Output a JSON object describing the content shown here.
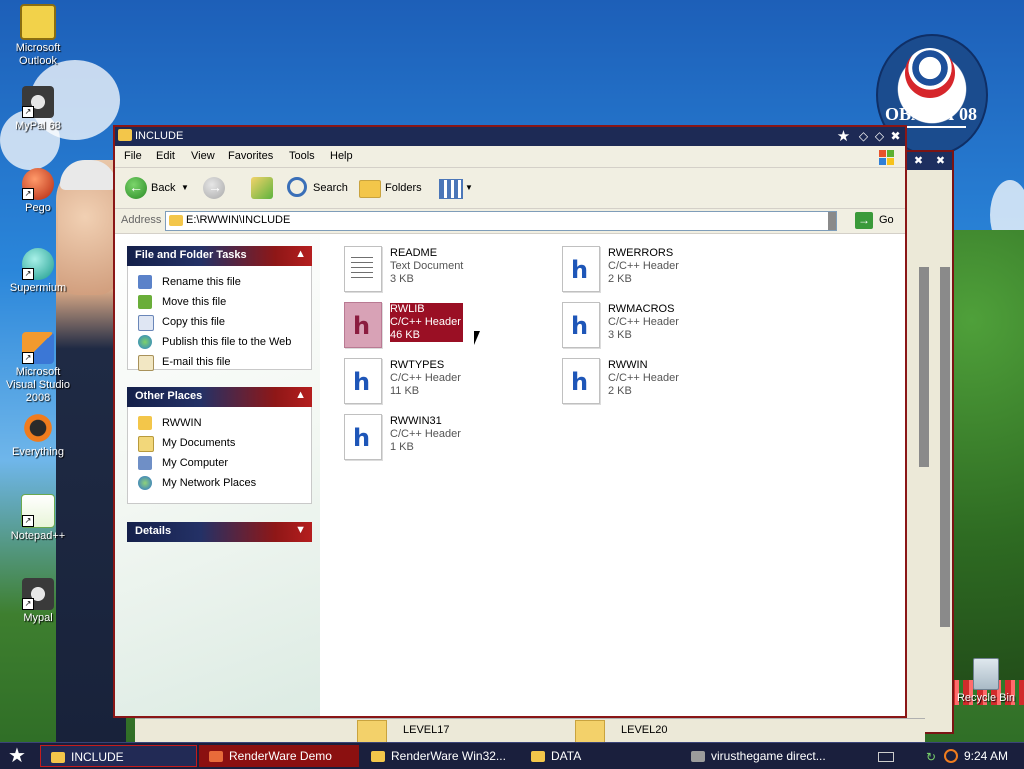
{
  "desktop": {
    "icons": [
      {
        "label": "Microsoft Outlook"
      },
      {
        "label": "MyPal 68"
      },
      {
        "label": "Pego"
      },
      {
        "label": "Supermium"
      },
      {
        "label": "Microsoft Visual Studio 2008"
      },
      {
        "label": "Everything"
      },
      {
        "label": "Notepad++"
      },
      {
        "label": "Mypal"
      },
      {
        "label": "Recycle Bin"
      }
    ],
    "badge_text": "OBAMA'08"
  },
  "window": {
    "title": "INCLUDE",
    "menu": [
      "File",
      "Edit",
      "View",
      "Favorites",
      "Tools",
      "Help"
    ],
    "toolbar": {
      "back": "Back",
      "search": "Search",
      "folders": "Folders"
    },
    "address": {
      "label": "Address",
      "path": "E:\\RWWIN\\INCLUDE",
      "go": "Go"
    }
  },
  "taskpane": {
    "file_tasks": {
      "title": "File and Folder Tasks",
      "items": [
        "Rename this file",
        "Move this file",
        "Copy this file",
        "Publish this file to the Web",
        "E-mail this file"
      ]
    },
    "other_places": {
      "title": "Other Places",
      "items": [
        "RWWIN",
        "My Documents",
        "My Computer",
        "My Network Places"
      ]
    },
    "details": {
      "title": "Details"
    }
  },
  "files": [
    {
      "name": "README",
      "type": "Text Document",
      "size": "3 KB",
      "icon": "text-document"
    },
    {
      "name": "RWERRORS",
      "type": "C/C++ Header",
      "size": "2 KB",
      "icon": "header-file"
    },
    {
      "name": "RWLIB",
      "type": "C/C++ Header",
      "size": "46 KB",
      "icon": "header-file",
      "selected": true
    },
    {
      "name": "RWMACROS",
      "type": "C/C++ Header",
      "size": "3 KB",
      "icon": "header-file"
    },
    {
      "name": "RWTYPES",
      "type": "C/C++ Header",
      "size": "11 KB",
      "icon": "header-file"
    },
    {
      "name": "RWWIN",
      "type": "C/C++ Header",
      "size": "2 KB",
      "icon": "header-file"
    },
    {
      "name": "RWWIN31",
      "type": "C/C++ Header",
      "size": "1 KB",
      "icon": "header-file"
    }
  ],
  "background_strip": {
    "items": [
      "LEVEL17",
      "LEVEL20"
    ]
  },
  "taskbar": {
    "tasks": [
      {
        "label": "INCLUDE",
        "active": true
      },
      {
        "label": "RenderWare Demo"
      },
      {
        "label": "RenderWare Win32..."
      },
      {
        "label": "DATA"
      },
      {
        "label": "virusthegame direct..."
      }
    ],
    "clock": "9:24 AM"
  },
  "colors": {
    "accent_red": "#9a0f24",
    "titlebar_navy": "#1d2a55"
  }
}
